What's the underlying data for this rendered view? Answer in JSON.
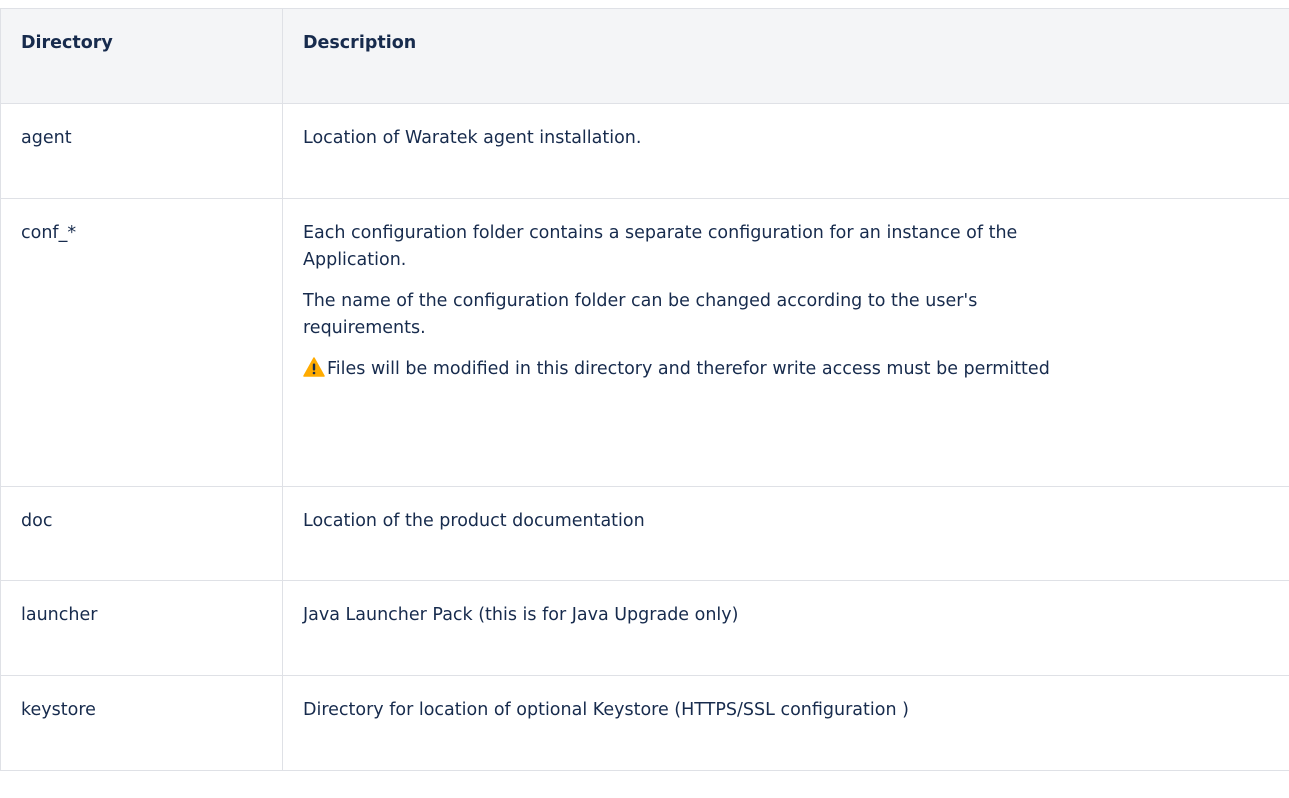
{
  "table": {
    "headers": [
      "Directory",
      "Description"
    ],
    "rows": [
      {
        "directory": "agent",
        "description": "Location of Waratek agent installation."
      },
      {
        "directory": "conf_*",
        "description_line1a": "Each configuration folder contains a separate configuration for an instance of the",
        "description_line1b": "Application.",
        "description_line2a": "The name of the configuration folder can be changed according to the user's",
        "description_line2b": "requirements.",
        "warning_icon": "warning-triangle-icon",
        "warning_text": "Files will be modified in this directory and therefor write access must be permitted"
      },
      {
        "directory": "doc",
        "description": "Location of the product documentation"
      },
      {
        "directory": "launcher",
        "description": "Java Launcher Pack (this is for Java Upgrade only)"
      },
      {
        "directory": "keystore",
        "description": "Directory for location of optional Keystore (HTTPS/SSL configuration )"
      }
    ]
  },
  "colors": {
    "header_bg": "#f4f5f7",
    "border": "#dfe1e6",
    "text": "#172b4d",
    "warning": "#ffab00"
  }
}
